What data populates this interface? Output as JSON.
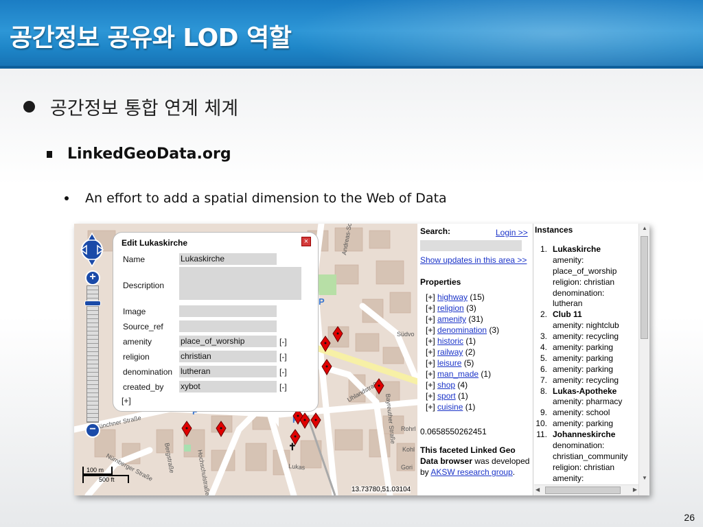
{
  "slide": {
    "title": "공간정보 공유와 LOD 역할",
    "bullet1": "공간정보 통합 연계 체계",
    "bullet2": "LinkedGeoData.org",
    "bullet3": "An effort to add a spatial dimension to the Web of Data",
    "page_number": "26"
  },
  "map": {
    "scale_m": "100 m",
    "scale_ft": "500 ft",
    "coords": "13.73780,51.03104",
    "zoom_in": "+",
    "zoom_out": "−",
    "parking_label": "P",
    "street_labels": [
      "Andreas-Schubert-Str.",
      "Münchner Straße",
      "Bergstraße",
      "Hochschulstraße",
      "Nürnberger Straße",
      "Bayreuther Straße",
      "Uhlandstraße",
      "Lukas",
      "Südvo",
      "Rohrl",
      "Kohl",
      "Gori"
    ]
  },
  "edit_popup": {
    "title": "Edit Lukaskirche",
    "close": "×",
    "add": "[+]",
    "fields": [
      {
        "label": "Name",
        "value": "Lukaskirche",
        "remove": ""
      },
      {
        "label": "Description",
        "value": "",
        "remove": ""
      },
      {
        "label": "Image",
        "value": "",
        "remove": ""
      },
      {
        "label": "Source_ref",
        "value": "",
        "remove": ""
      },
      {
        "label": "amenity",
        "value": "place_of_worship",
        "remove": "[-]"
      },
      {
        "label": "religion",
        "value": "christian",
        "remove": "[-]"
      },
      {
        "label": "denomination",
        "value": "lutheran",
        "remove": "[-]"
      },
      {
        "label": "created_by",
        "value": "xybot",
        "remove": "[-]"
      }
    ]
  },
  "search_panel": {
    "heading": "Search:",
    "login": "Login >>",
    "search_value": "",
    "show_updates": "Show updates in this area >>",
    "properties_heading": "Properties",
    "properties": [
      {
        "toggle": "[+]",
        "name": "highway",
        "count": "(15)"
      },
      {
        "toggle": "[+]",
        "name": "religion",
        "count": "(3)"
      },
      {
        "toggle": "[+]",
        "name": "amenity",
        "count": "(31)"
      },
      {
        "toggle": "[+]",
        "name": "denomination",
        "count": "(3)"
      },
      {
        "toggle": "[+]",
        "name": "historic",
        "count": "(1)"
      },
      {
        "toggle": "[+]",
        "name": "railway",
        "count": "(2)"
      },
      {
        "toggle": "[+]",
        "name": "leisure",
        "count": "(5)"
      },
      {
        "toggle": "[+]",
        "name": "man_made",
        "count": "(1)"
      },
      {
        "toggle": "[+]",
        "name": "shop",
        "count": "(4)"
      },
      {
        "toggle": "[+]",
        "name": "sport",
        "count": "(1)"
      },
      {
        "toggle": "[+]",
        "name": "cuisine",
        "count": "(1)"
      }
    ],
    "number": "0.0658550262451",
    "credit_bold": "This faceted Linked Geo Data browser",
    "credit_mid": " was developed by ",
    "credit_link": "AKSW research group",
    "credit_end": "."
  },
  "instances": {
    "heading": "Instances",
    "lines": [
      {
        "n": "1.",
        "t": "Lukaskirche",
        "title": true
      },
      {
        "n": "",
        "t": "amenity:",
        "title": false
      },
      {
        "n": "",
        "t": "place_of_worship",
        "title": false
      },
      {
        "n": "",
        "t": "religion: christian",
        "title": false
      },
      {
        "n": "",
        "t": "denomination:",
        "title": false
      },
      {
        "n": "",
        "t": "lutheran",
        "title": false
      },
      {
        "n": "2.",
        "t": "Club 11",
        "title": true
      },
      {
        "n": "",
        "t": "amenity: nightclub",
        "title": false
      },
      {
        "n": "3.",
        "t": "amenity: recycling",
        "title": false
      },
      {
        "n": "4.",
        "t": "amenity: parking",
        "title": false
      },
      {
        "n": "5.",
        "t": "amenity: parking",
        "title": false
      },
      {
        "n": "6.",
        "t": "amenity: parking",
        "title": false
      },
      {
        "n": "7.",
        "t": "amenity: recycling",
        "title": false
      },
      {
        "n": "8.",
        "t": "Lukas-Apotheke",
        "title": true
      },
      {
        "n": "",
        "t": "amenity: pharmacy",
        "title": false
      },
      {
        "n": "9.",
        "t": "amenity: school",
        "title": false
      },
      {
        "n": "10.",
        "t": "amenity: parking",
        "title": false
      },
      {
        "n": "11.",
        "t": "Johanneskirche",
        "title": true
      },
      {
        "n": "",
        "t": "denomination:",
        "title": false
      },
      {
        "n": "",
        "t": "christian_community",
        "title": false
      },
      {
        "n": "",
        "t": "religion: christian",
        "title": false
      },
      {
        "n": "",
        "t": "amenity:",
        "title": false
      }
    ]
  }
}
